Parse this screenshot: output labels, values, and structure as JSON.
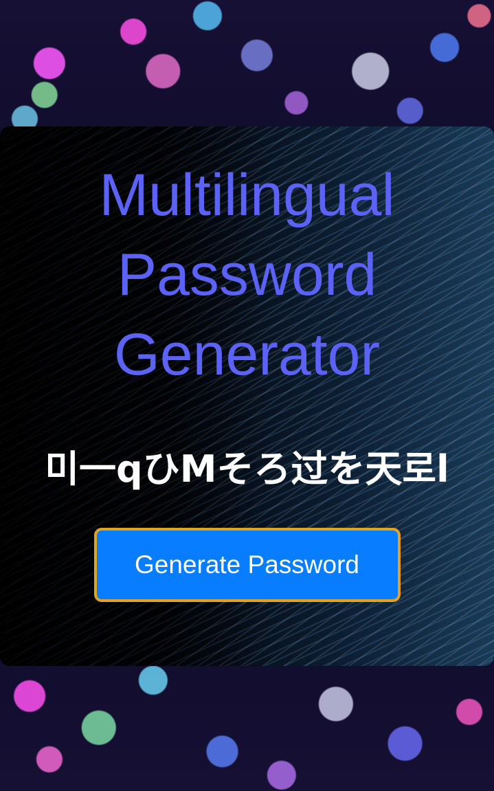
{
  "app": {
    "title": "Multilingual Password Generator"
  },
  "password": {
    "value": "미一qひMそろ过を天로l"
  },
  "actions": {
    "generate_label": "Generate Password"
  },
  "colors": {
    "title": "#5b62f5",
    "password_text": "#ffffff",
    "button_bg": "#087dff",
    "button_border": "#e3a223",
    "button_text": "#ffffff"
  }
}
